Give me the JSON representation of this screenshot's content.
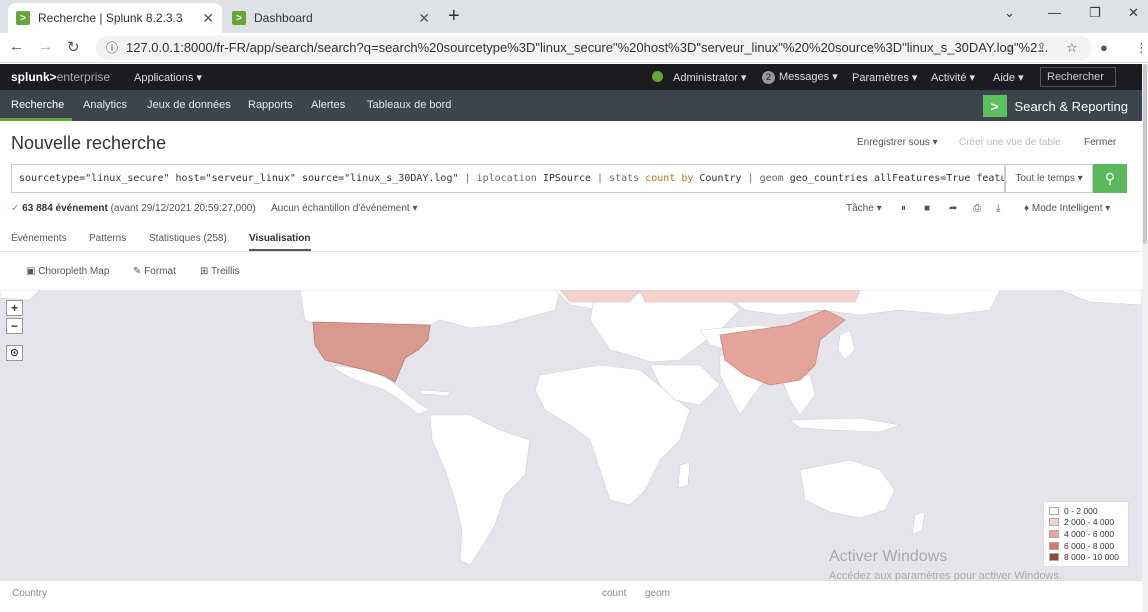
{
  "browser": {
    "tabs": [
      {
        "title": "Recherche | Splunk 8.2.3.3",
        "favicon": ">"
      },
      {
        "title": "Dashboard",
        "favicon": ">"
      }
    ],
    "url": "127.0.0.1:8000/fr-FR/app/search/search?q=search%20sourcetype%3D\"linux_secure\"%20host%3D\"serveur_linux\"%20%20source%3D\"linux_s_30DAY.log\"%2..."
  },
  "splunk": {
    "logo_main": "splunk>",
    "logo_sub": "enterprise",
    "apps_label": "Applications ▾",
    "user_label": "Administrator ▾",
    "messages_count": "2",
    "messages_label": "Messages ▾",
    "settings_label": "Paramètres ▾",
    "activity_label": "Activité ▾",
    "help_label": "Aide ▾",
    "search_placeholder": "Rechercher"
  },
  "appnav": {
    "items": [
      "Recherche",
      "Analytics",
      "Jeux de données",
      "Rapports",
      "Alertes",
      "Tableaux de bord"
    ],
    "app_name": "Search & Reporting"
  },
  "page": {
    "title": "Nouvelle recherche",
    "save_as": "Enregistrer sous ▾",
    "create_table": "Créer une vue de table",
    "close": "Fermer"
  },
  "search": {
    "q1": "sourcetype=\"linux_secure\" host=\"serveur_linux\"  source=\"linux_s_30DAY.log\" ",
    "pipe": "| ",
    "c1": "iplocation",
    "a1": " IPSource ",
    "c2": "stats",
    "kw1": " count ",
    "kw2": "by",
    "a2": " Country ",
    "c3": "geom",
    "a3": " geo_countries allFeatures=True featureIdField=Country",
    "time_range": "Tout le temps ▾",
    "go_icon": "search-icon"
  },
  "status": {
    "event_count": "63 884 événement",
    "event_date": "(avant 29/12/2021 20:59:27,000)",
    "sampling": "Aucun échantillon d'événement ▾",
    "job": "Tâche ▾",
    "mode": "Mode Intelligent ▾"
  },
  "result_tabs": [
    "Événements",
    "Patterns",
    "Statistiques (258)",
    "Visualisation"
  ],
  "vis_tools": [
    "Choropleth Map",
    "Format",
    "Treillis"
  ],
  "map": {
    "zoom_in": "+",
    "zoom_out": "−",
    "legend": [
      {
        "label": "0 - 2 000",
        "color": "#ffffff"
      },
      {
        "label": "2 000 - 4 000",
        "color": "#f2d2cc"
      },
      {
        "label": "4 000 - 6 000",
        "color": "#e3a59b"
      },
      {
        "label": "6 000 - 8 000",
        "color": "#d2796b"
      },
      {
        "label": "8 000 - 10 000",
        "color": "#8c4a3f"
      }
    ],
    "watermark_title": "Activer Windows",
    "watermark_sub": "Accédez aux paramètres pour activer Windows."
  },
  "table": {
    "columns": [
      "Country",
      "count",
      "geom"
    ]
  }
}
